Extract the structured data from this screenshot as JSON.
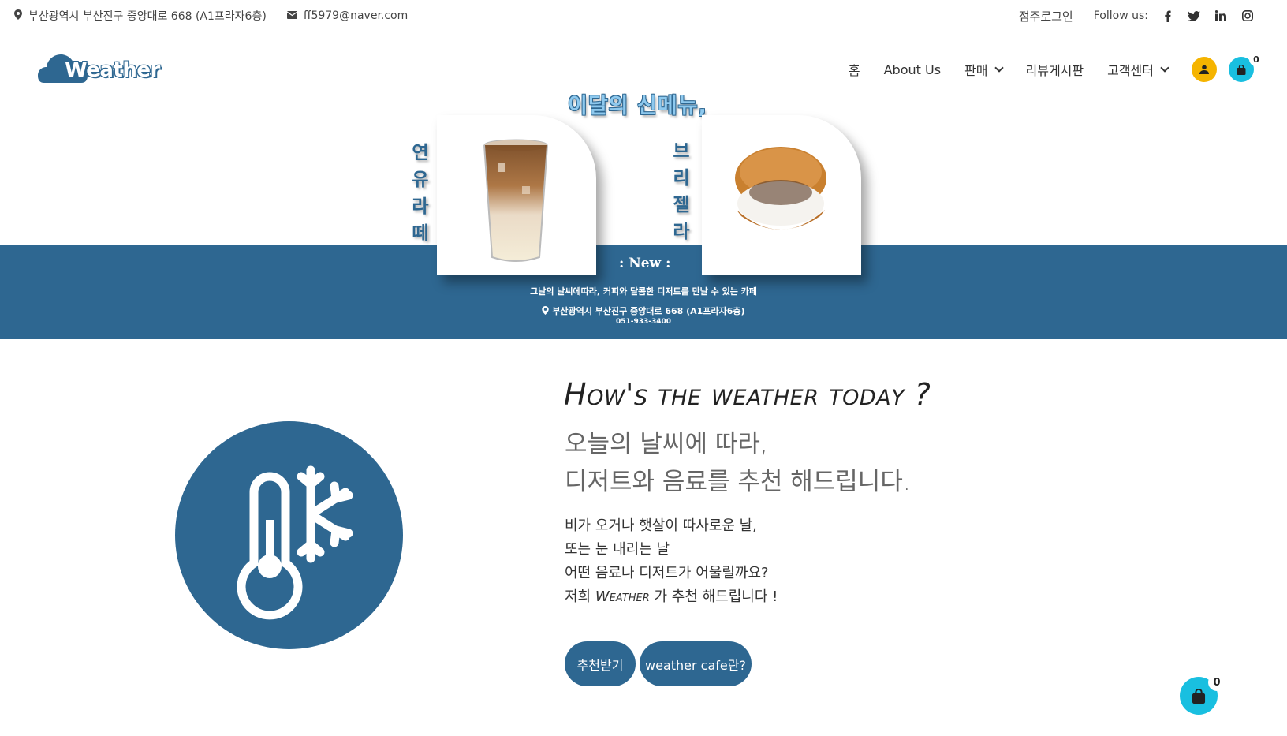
{
  "topbar": {
    "address": "부산광역시 부산진구 중앙대로 668 (A1프라자6층)",
    "email": "ff5979@naver.com",
    "owner_login": "점주로그인",
    "follow_us": "Follow us:",
    "social_icons": [
      "facebook-icon",
      "twitter-icon",
      "linkedin-icon",
      "instagram-icon"
    ]
  },
  "header": {
    "logo_text": "Weather",
    "nav": {
      "home": "홈",
      "about": "About Us",
      "sales": "판매",
      "reviews": "리뷰게시판",
      "support": "고객센터"
    },
    "cart_count": "0"
  },
  "banner": {
    "title": "이달의 신메뉴,",
    "item1_name": [
      "연",
      "유",
      "라",
      "떼"
    ],
    "item2_name": [
      "브",
      "리",
      "젤",
      "라"
    ],
    "new_label": ": New :",
    "tagline": "그날의 날씨에따라, 커피와 달콤한 디저트를 만날 수 있는 카페",
    "address": "부산광역시 부산진구 중앙대로 668 (A1프라자6층)",
    "phone": "051-933-3400"
  },
  "main": {
    "heading": "How's the weather today ?",
    "sub1": "오늘의 날씨에 따라,",
    "sub2": "디저트와 음료를 추천 해드립니다.",
    "line1": "비가 오거나 햇살이 따사로운 날,",
    "line2": "또는 눈 내리는 날",
    "line3": "어떤 음료나 디저트가 어울릴까요?",
    "line4_prefix": "저희 ",
    "line4_brand": "Weather",
    "line4_suffix": " 가 추천 해드립니다 !",
    "btn_recommend": "추천받기",
    "btn_about": "weather cafe란?"
  },
  "floating_cart": {
    "count": "0"
  },
  "colors": {
    "brand": "#2e6791",
    "cart": "#19bfe0",
    "user": "#f5b400"
  }
}
